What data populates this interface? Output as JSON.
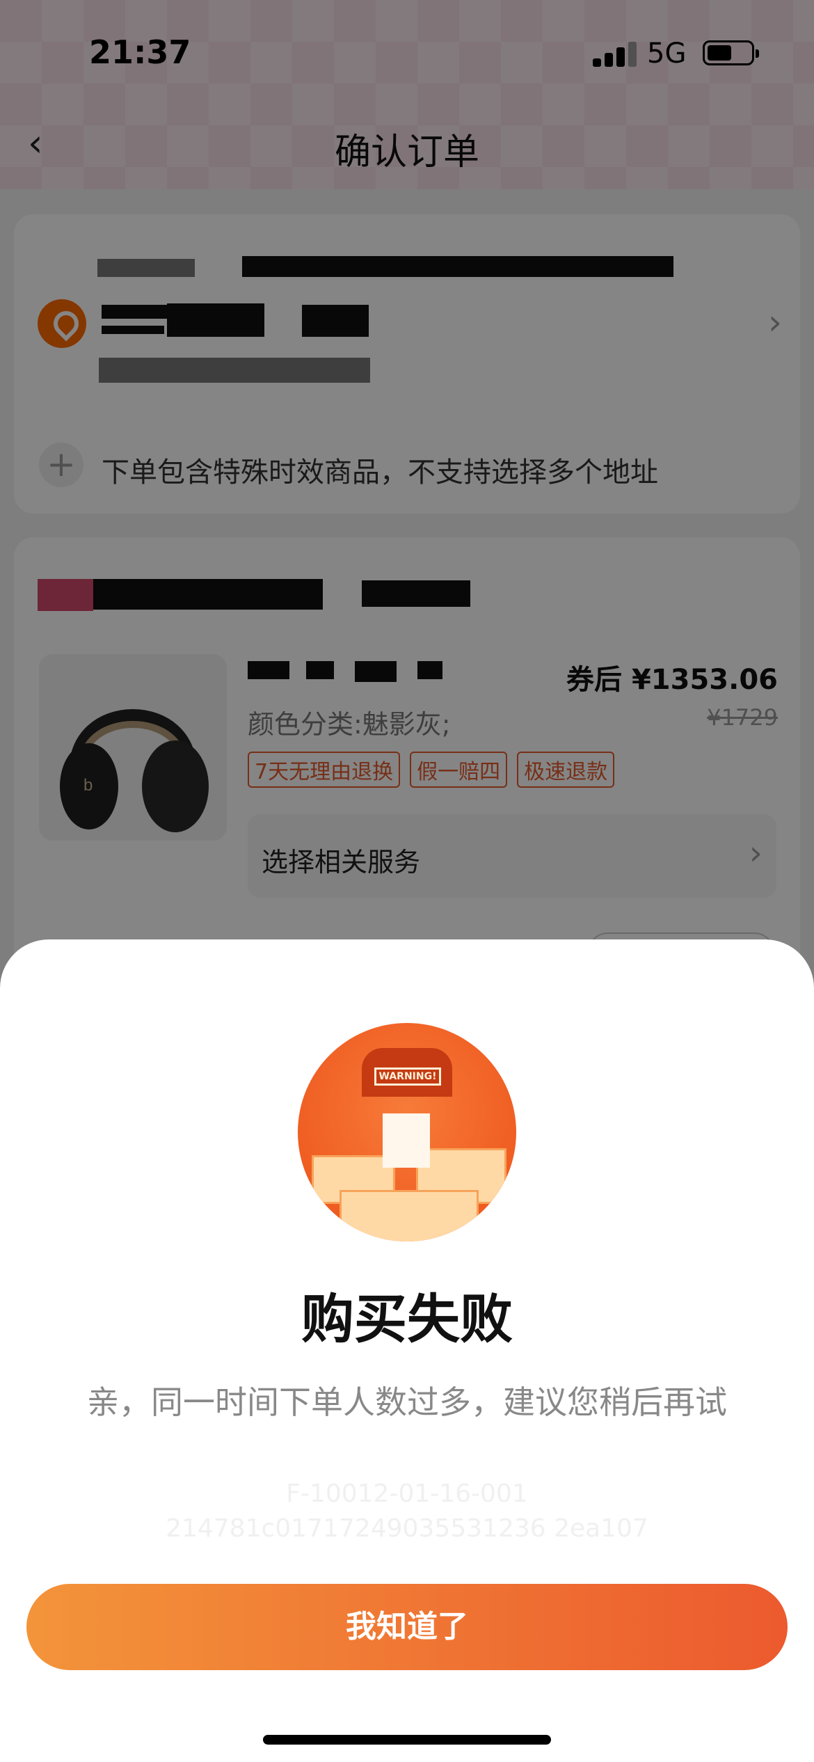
{
  "status_bar": {
    "time": "21:37",
    "network": "5G"
  },
  "nav": {
    "title": "确认订单"
  },
  "address": {
    "note": "下单包含特殊时效商品，不支持选择多个地址"
  },
  "product": {
    "coupon_price": "券后 ¥1353.06",
    "sku": "颜色分类:魅影灰;",
    "original_price": "¥1729",
    "tags": [
      "7天无理由退换",
      "假一赔四",
      "极速退款"
    ],
    "service_label": "选择相关服务"
  },
  "dialog": {
    "title": "购买失败",
    "message": "亲，同一时间下单人数过多，建议您稍后再试",
    "code_line1": "F-10012-01-16-001",
    "code_line2": "214781c01717249035531236 2ea107",
    "button": "我知道了",
    "illustration_text": "WARNING!"
  },
  "colors": {
    "accent": "#ec5a2e",
    "accent_start": "#f3943a"
  }
}
